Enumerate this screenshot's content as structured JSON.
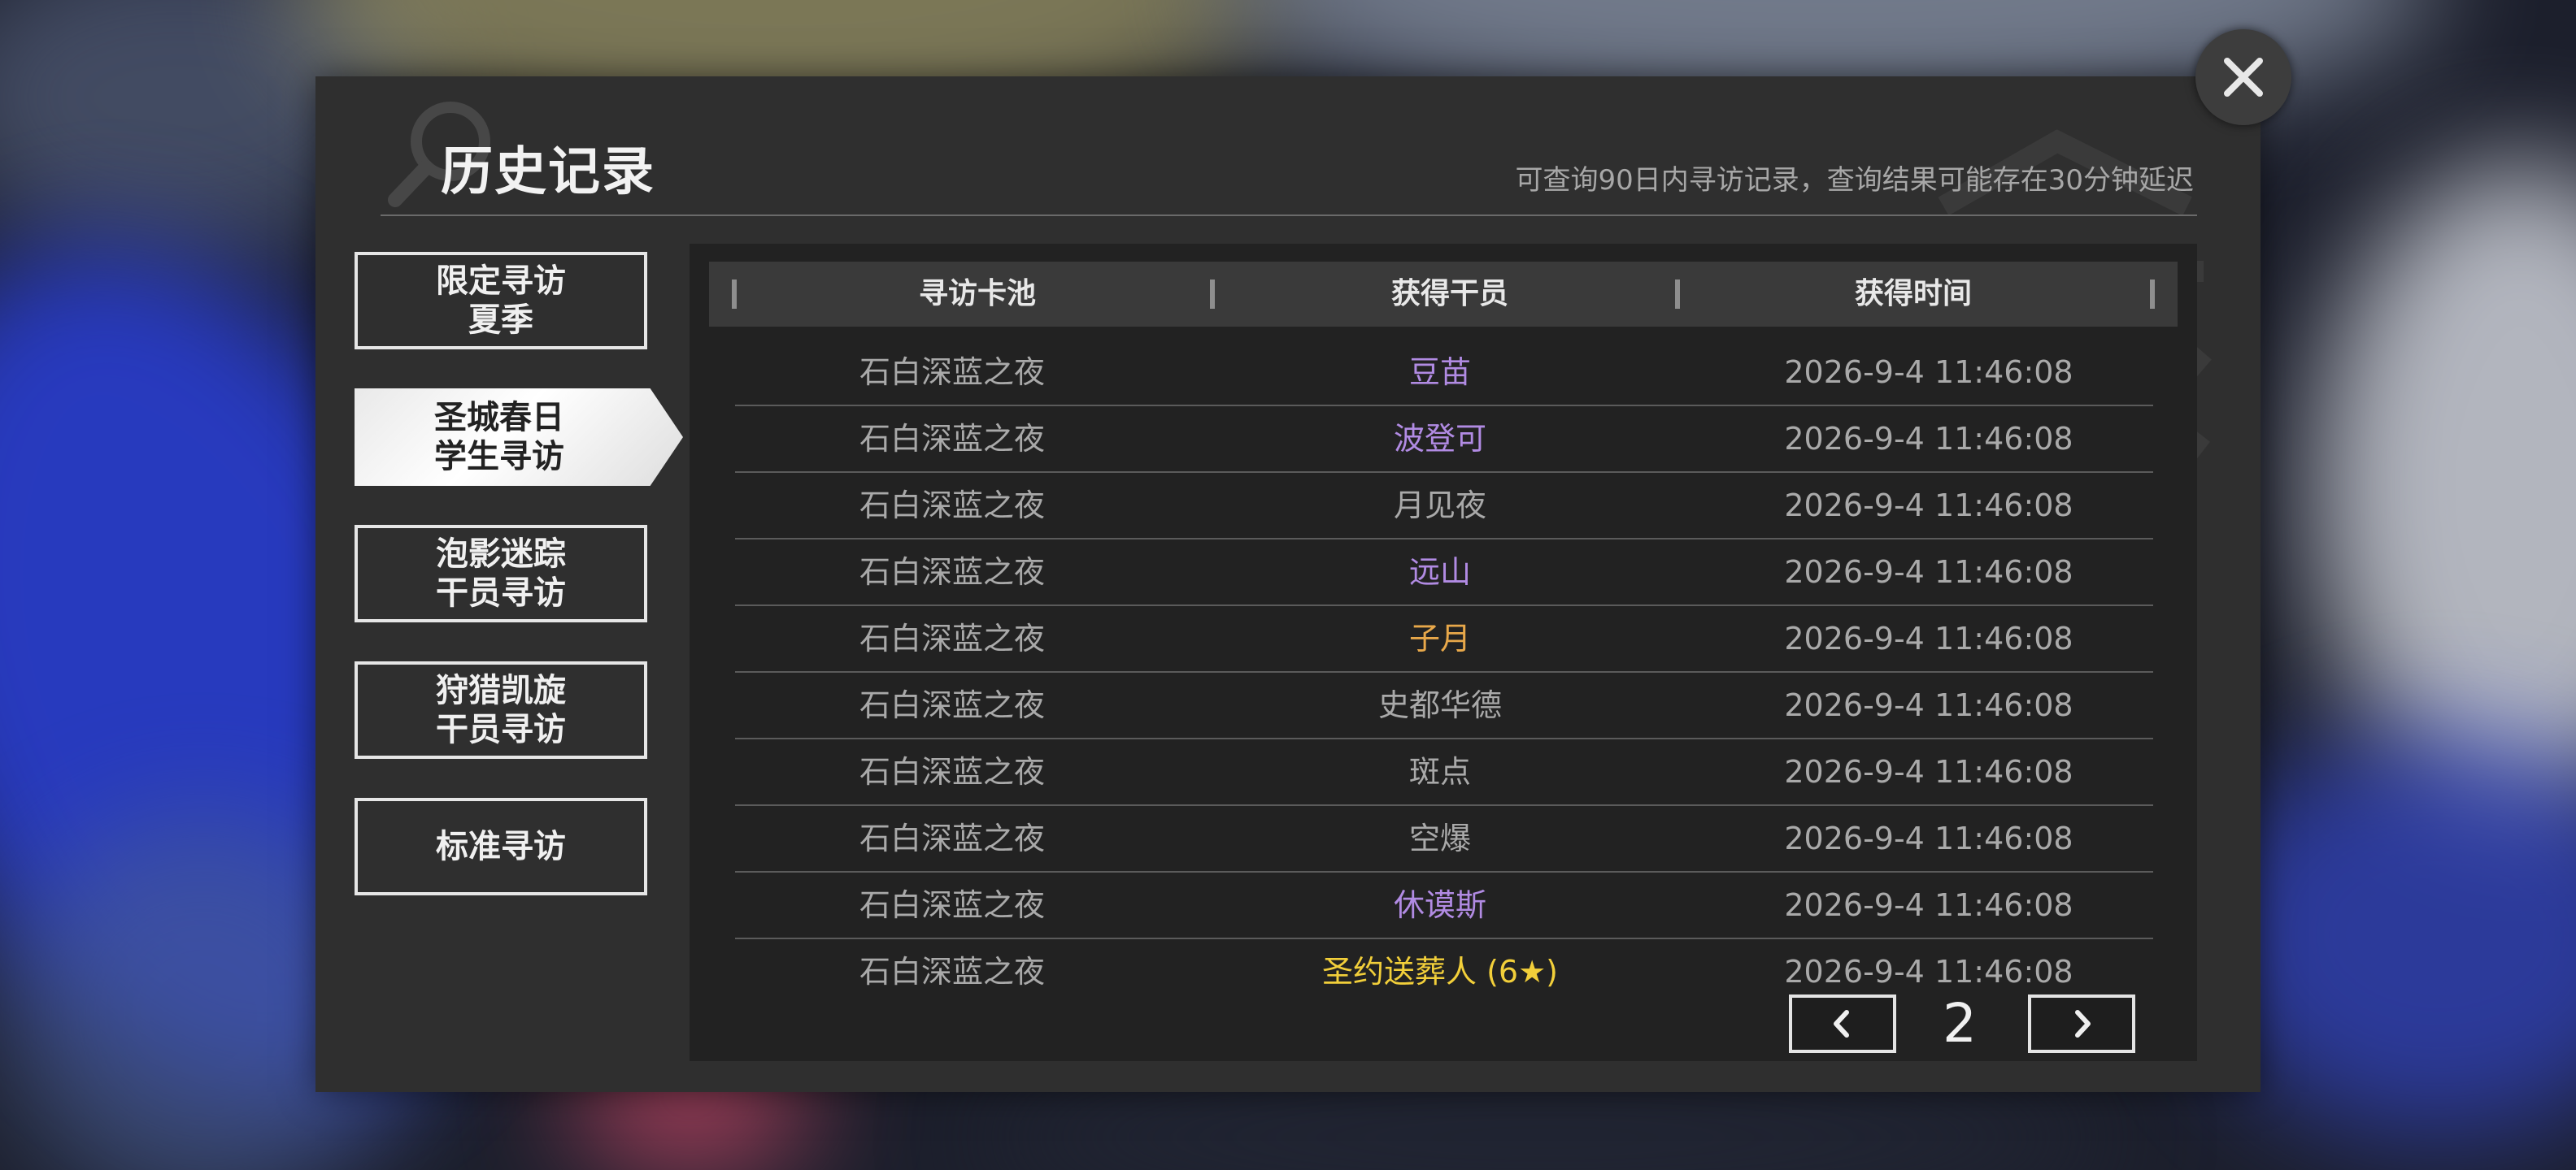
{
  "dialog": {
    "title": "历史记录",
    "subtitle": "可查询90日内寻访记录，查询结果可能存在30分钟延迟"
  },
  "side_tabs": [
    {
      "label": "限定寻访\n夏季",
      "active": false
    },
    {
      "label": "圣城春日\n学生寻访",
      "active": true
    },
    {
      "label": "泡影迷踪\n干员寻访",
      "active": false
    },
    {
      "label": "狩猎凯旋\n干员寻访",
      "active": false
    },
    {
      "label": "标准寻访",
      "active": false
    }
  ],
  "table": {
    "headers": [
      "寻访卡池",
      "获得干员",
      "获得时间"
    ],
    "rows": [
      {
        "pool": "石白深蓝之夜",
        "operator": "豆苗",
        "time": "2026-9-4 11:46:08",
        "color": "#b18be3"
      },
      {
        "pool": "石白深蓝之夜",
        "operator": "波登可",
        "time": "2026-9-4 11:46:08",
        "color": "#b18be3"
      },
      {
        "pool": "石白深蓝之夜",
        "operator": "月见夜",
        "time": "2026-9-4 11:46:08",
        "color": "#a9a9a9"
      },
      {
        "pool": "石白深蓝之夜",
        "operator": "远山",
        "time": "2026-9-4 11:46:08",
        "color": "#b18be3"
      },
      {
        "pool": "石白深蓝之夜",
        "operator": "子月",
        "time": "2026-9-4 11:46:08",
        "color": "#e8a84a"
      },
      {
        "pool": "石白深蓝之夜",
        "operator": "史都华德",
        "time": "2026-9-4 11:46:08",
        "color": "#a9a9a9"
      },
      {
        "pool": "石白深蓝之夜",
        "operator": "斑点",
        "time": "2026-9-4 11:46:08",
        "color": "#a9a9a9"
      },
      {
        "pool": "石白深蓝之夜",
        "operator": "空爆",
        "time": "2026-9-4 11:46:08",
        "color": "#a9a9a9"
      },
      {
        "pool": "石白深蓝之夜",
        "operator": "休谟斯",
        "time": "2026-9-4 11:46:08",
        "color": "#b18be3"
      },
      {
        "pool": "石白深蓝之夜",
        "operator": "圣约送葬人 (6★)",
        "time": "2026-9-4 11:46:08",
        "color": "#f2cf3a"
      }
    ]
  },
  "pagination": {
    "current_page": "2"
  },
  "colors": {
    "panel_bg": "#2f2f2f",
    "table_bg": "#222222",
    "rarity_4_purple": "#b18be3",
    "rarity_5_orange": "#e8a84a",
    "rarity_6_gold": "#f2cf3a",
    "rarity_low_gray": "#a9a9a9"
  },
  "icons": {
    "close": "close-icon",
    "prev": "chevron-left-icon",
    "next": "chevron-right-icon",
    "title_decor": "search-icon"
  }
}
